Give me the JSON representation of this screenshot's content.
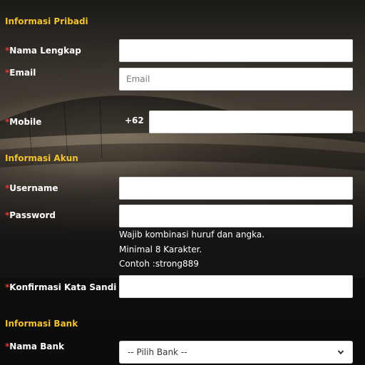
{
  "sections": {
    "personal": "Informasi Pribadi",
    "account": "Informasi Akun",
    "bank": "Informasi Bank"
  },
  "required_mark": "*",
  "fields": {
    "full_name": {
      "label": "Nama Lengkap",
      "value": "",
      "placeholder": ""
    },
    "email": {
      "label": "Email",
      "value": "",
      "placeholder": "Email"
    },
    "mobile": {
      "label": "Mobile",
      "prefix": "+62",
      "value": "",
      "placeholder": ""
    },
    "username": {
      "label": "Username",
      "value": "",
      "placeholder": ""
    },
    "password": {
      "label": "Password",
      "value": "",
      "placeholder": ""
    },
    "confirm_password": {
      "label": "Konfirmasi Kata Sandi",
      "value": "",
      "placeholder": ""
    },
    "bank_name": {
      "label": "Nama Bank",
      "selected": "-- Pilih Bank --"
    }
  },
  "password_hints": [
    "Wajib kombinasi huruf dan angka.",
    "Minimal 8 Karakter.",
    "Contoh :strong889"
  ],
  "colors": {
    "section_title": "#f2c233",
    "required": "#e03a2f",
    "label": "#ffffff"
  },
  "icons": {
    "select_arrow": "chevron-down-icon"
  }
}
